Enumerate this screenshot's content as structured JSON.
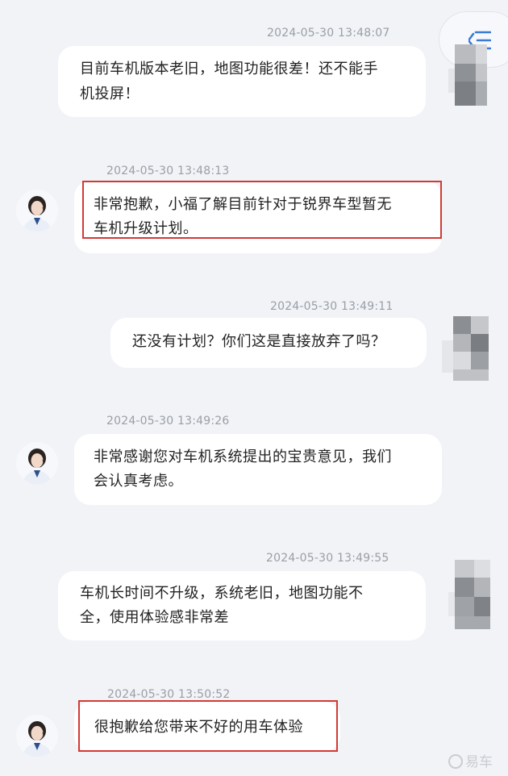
{
  "menu_button": {
    "icon": "menu-collapse-icon"
  },
  "messages": [
    {
      "sender": "user",
      "timestamp": "2024-05-30 13:48:07",
      "lines": [
        "目前车机版本老旧，地图功能很差！还不能手",
        "机投屏！"
      ]
    },
    {
      "sender": "agent",
      "timestamp": "2024-05-30 13:48:13",
      "lines": [
        "非常抱歉，小福了解目前针对于锐界车型暂无",
        "车机升级计划。"
      ],
      "highlighted": true
    },
    {
      "sender": "user",
      "timestamp": "2024-05-30 13:49:11",
      "lines": [
        "还没有计划？你们这是直接放弃了吗？"
      ]
    },
    {
      "sender": "agent",
      "timestamp": "2024-05-30 13:49:26",
      "lines": [
        "非常感谢您对车机系统提出的宝贵意见，我们",
        "会认真考虑。"
      ]
    },
    {
      "sender": "user",
      "timestamp": "2024-05-30 13:49:55",
      "lines": [
        "车机长时间不升级，系统老旧，地图功能不",
        "全，使用体验感非常差"
      ]
    },
    {
      "sender": "agent",
      "timestamp": "2024-05-30 13:50:52",
      "lines": [
        "很抱歉给您带来不好的用车体验"
      ],
      "highlighted": true
    }
  ],
  "watermark": {
    "text": "易车",
    "icon": "yiche-logo-icon"
  },
  "colors": {
    "background": "#f1f3f7",
    "bubble": "#ffffff",
    "highlight_border": "#d23a35",
    "timestamp": "#9a9ea6",
    "menu_icon": "#3a7bd5"
  }
}
